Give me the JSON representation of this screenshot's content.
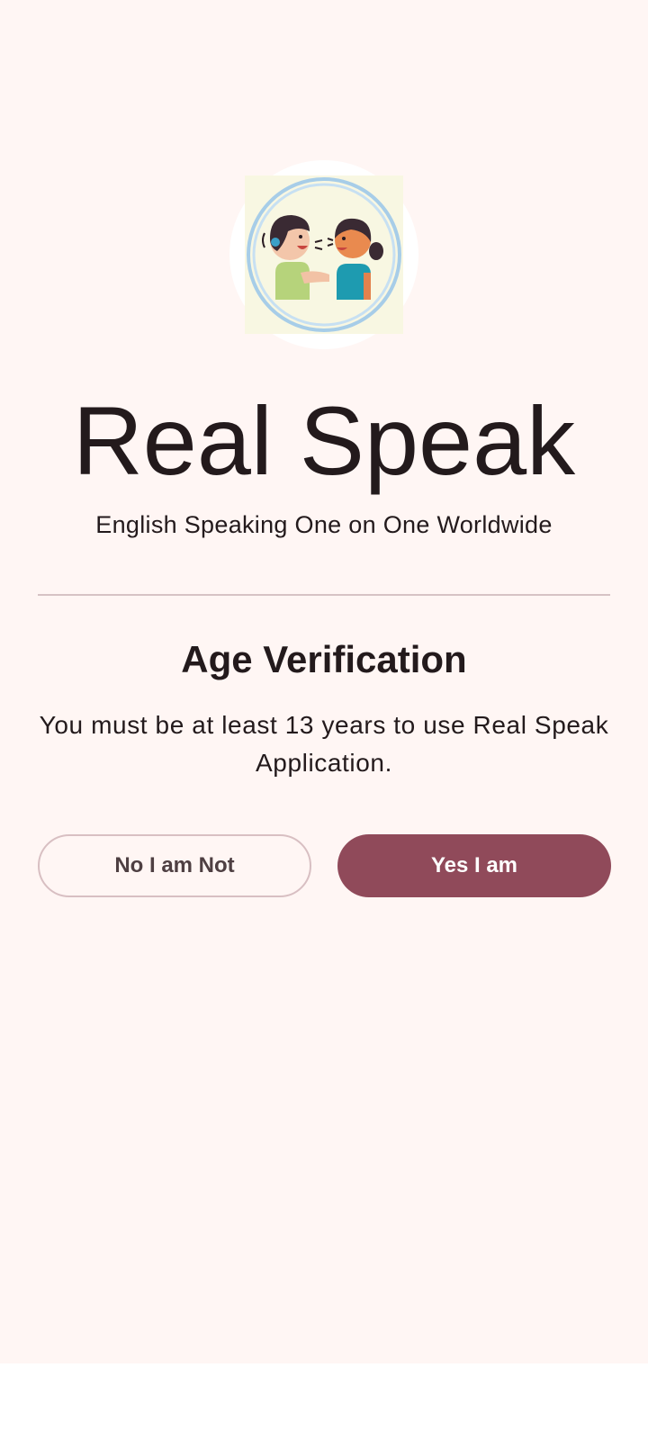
{
  "app": {
    "title": "Real Speak",
    "subtitle": "English Speaking One on One Worldwide"
  },
  "logo": {
    "icon": "two-kids-talking-logo-icon"
  },
  "age_verification": {
    "title": "Age Verification",
    "message": "You must be at least 13 years to use Real Speak Application."
  },
  "actions": {
    "decline_label": "No I am Not",
    "accept_label": "Yes I am"
  },
  "colors": {
    "background": "#fff6f4",
    "primary": "#904a5a",
    "text": "#231a1c",
    "outline": "#d8bfc2",
    "divider": "#d6c2c4"
  }
}
